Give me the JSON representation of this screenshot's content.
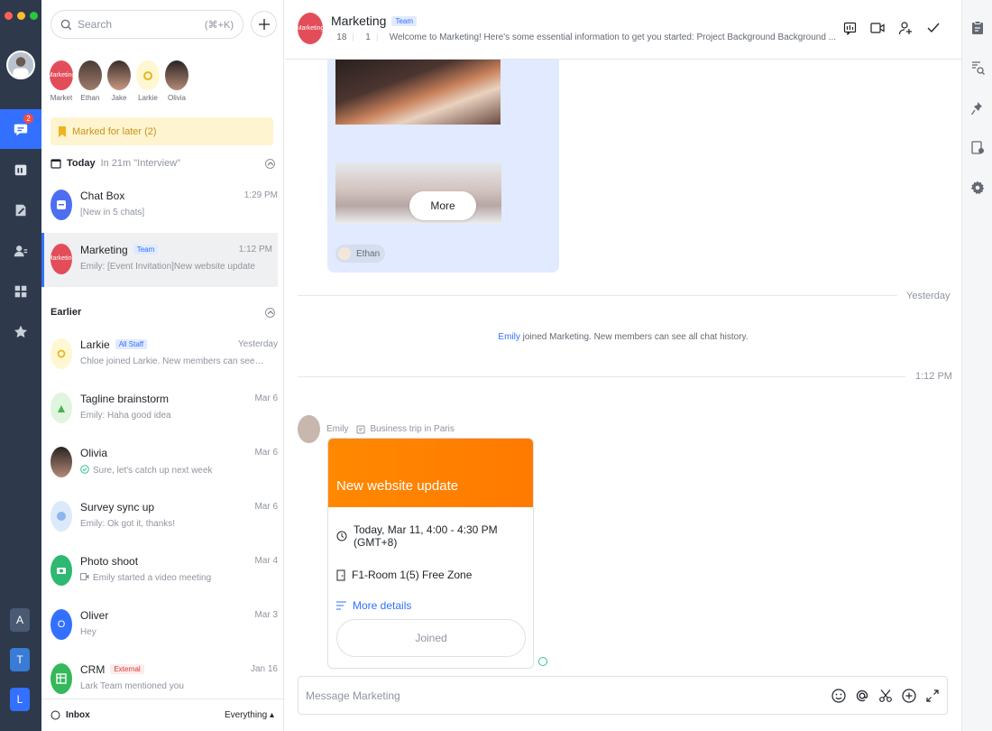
{
  "rail": {
    "badge": "2",
    "workspaces": [
      "A",
      "T",
      "L"
    ]
  },
  "search": {
    "placeholder": "Search",
    "shortcut": "(⌘+K)"
  },
  "pinned": [
    {
      "label": "Market",
      "avatar_text": "Marketing"
    },
    {
      "label": "Ethan"
    },
    {
      "label": "Jake"
    },
    {
      "label": "Larkie"
    },
    {
      "label": "Olivia"
    }
  ],
  "marked": {
    "label": "Marked for later (2)"
  },
  "today": {
    "title": "Today",
    "sub": "In 21m \"Interview\""
  },
  "earlier": {
    "title": "Earlier"
  },
  "chats": [
    {
      "name": "Chat Box",
      "time": "1:29 PM",
      "preview": "[New in 5 chats]"
    },
    {
      "name": "Marketing",
      "tag": "Team",
      "time": "1:12 PM",
      "preview": "Emily: [Event Invitation]New website update",
      "avatar_text": "Marketing"
    },
    {
      "name": "Larkie",
      "tag": "All Staff",
      "time": "Yesterday",
      "preview": "Chloe joined Larkie. New members can see all ..."
    },
    {
      "name": "Tagline brainstorm",
      "time": "Mar 6",
      "preview": "Emily: Haha good idea"
    },
    {
      "name": "Olivia",
      "time": "Mar 6",
      "preview": "Sure, let's catch up next week"
    },
    {
      "name": "Survey sync up",
      "time": "Mar 6",
      "preview": "Emily: Ok got it, thanks!"
    },
    {
      "name": "Photo shoot",
      "time": "Mar 4",
      "preview": "Emily started a video meeting"
    },
    {
      "name": "Oliver",
      "time": "Mar 3",
      "preview": "Hey",
      "avatar_text": "O"
    },
    {
      "name": "CRM",
      "tag": "External",
      "time": "Jan 16",
      "preview": "Lark Team mentioned you"
    }
  ],
  "footer": {
    "inbox": "Inbox",
    "filter": "Everything"
  },
  "header": {
    "title": "Marketing",
    "tag": "Team",
    "avatar_text": "Marketing",
    "members": "18",
    "bots": "1",
    "description": "Welcome to Marketing! Here's some essential information to get you started: Project Background Background ..."
  },
  "message1": {
    "more_label": "More",
    "author": "Ethan"
  },
  "divider_yesterday": "Yesterday",
  "system": {
    "who": "Emily",
    "text": " joined Marketing. New members can see all chat history."
  },
  "divider_time": "1:12 PM",
  "message2": {
    "sender": "Emily",
    "status": "Business trip in Paris",
    "event_title": "New website update",
    "when": "Today, Mar 11, 4:00 - 4:30 PM (GMT+8)",
    "where": "F1-Room 1(5) Free Zone",
    "more_details": "More details",
    "joined": "Joined"
  },
  "composer": {
    "placeholder": "Message Marketing"
  },
  "colors": {
    "accent": "#3370ff",
    "rail": "#2e3a4c",
    "event": "#ff8800"
  }
}
